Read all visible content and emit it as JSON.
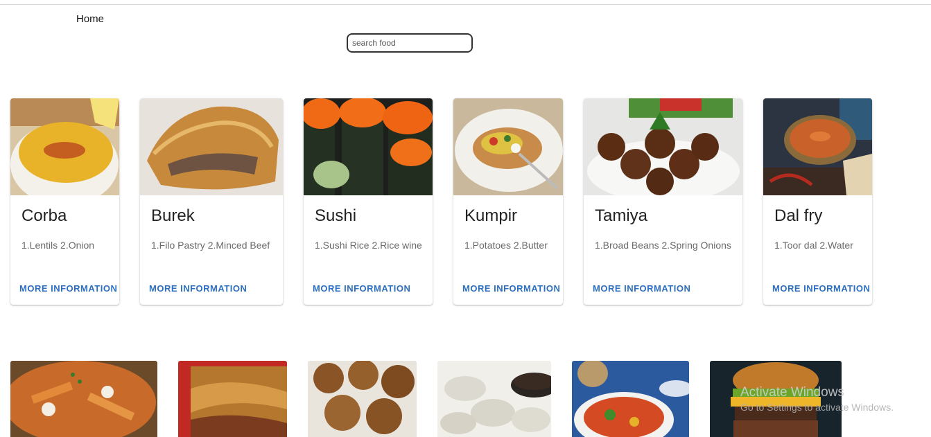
{
  "nav": {
    "home_label": "Home"
  },
  "search": {
    "placeholder": "search food",
    "value": ""
  },
  "cards": [
    {
      "title": "Corba",
      "ingredients": "1.Lentils 2.Onion",
      "more": "MORE INFORMATION",
      "image": "lentil-soup-photo"
    },
    {
      "title": "Burek",
      "ingredients": "1.Filo Pastry 2.Minced Beef",
      "more": "MORE INFORMATION",
      "image": "burek-pastry-photo"
    },
    {
      "title": "Sushi",
      "ingredients": "1.Sushi Rice 2.Rice wine",
      "more": "MORE INFORMATION",
      "image": "sushi-rolls-photo"
    },
    {
      "title": "Kumpir",
      "ingredients": "1.Potatoes 2.Butter",
      "more": "MORE INFORMATION",
      "image": "stuffed-potato-photo"
    },
    {
      "title": "Tamiya",
      "ingredients": "1.Broad Beans 2.Spring Onions",
      "more": "MORE INFORMATION",
      "image": "falafel-photo"
    },
    {
      "title": "Dal fry",
      "ingredients": "1.Toor dal 2.Water",
      "more": "MORE INFORMATION",
      "image": "dal-fry-photo"
    }
  ],
  "second_row_images": [
    "poutine-photo",
    "lasagna-photo",
    "fried-dough-photo",
    "dumplings-photo",
    "salad-plate-photo",
    "burger-photo"
  ],
  "watermark": {
    "title": "Activate Windows",
    "subtitle": "Go to Settings to activate Windows."
  },
  "colors": {
    "link": "#2d6fbf",
    "card_bg": "#ffffff",
    "search_border": "#333333"
  }
}
